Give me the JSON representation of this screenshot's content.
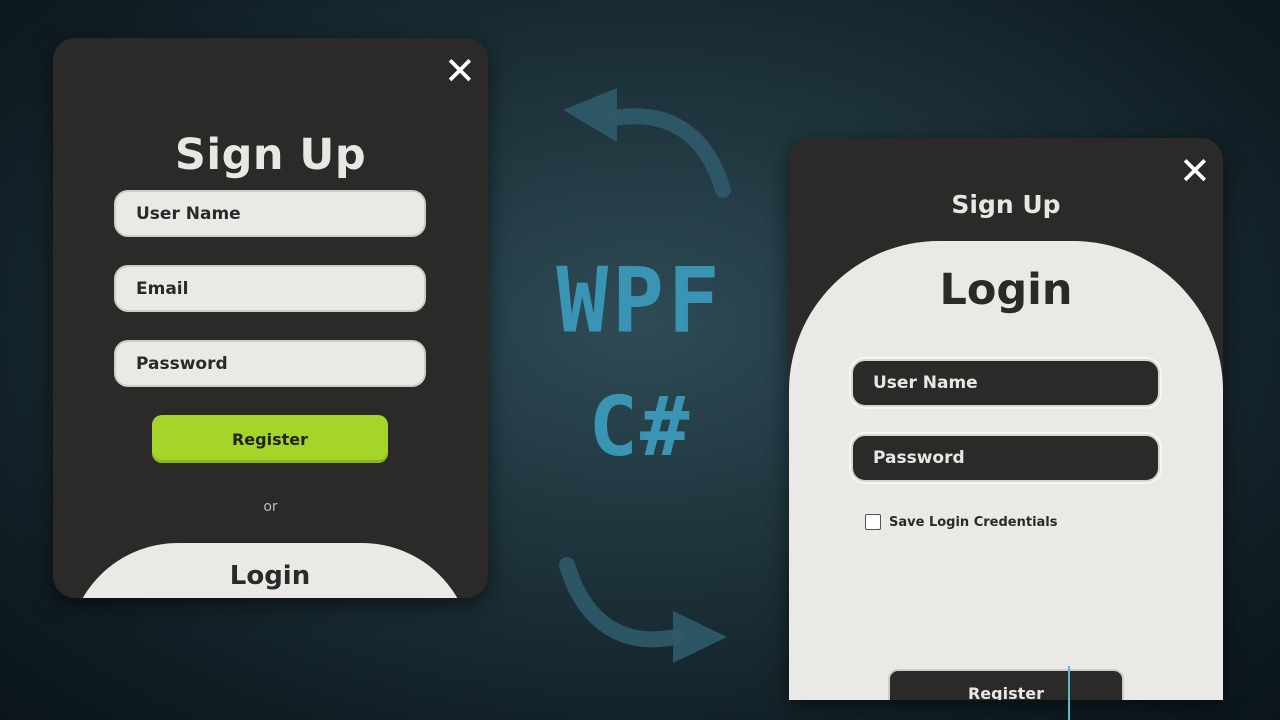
{
  "colors": {
    "background": "#1d3139",
    "window_dark": "#2b2a29",
    "panel_light": "#ebe9e6",
    "register_green": "#a6d52a",
    "accent_blue": "#3a95b4"
  },
  "center_text": {
    "line1": "WPF",
    "line2": "C#"
  },
  "left_window": {
    "close_icon": "✕",
    "title": "Sign Up",
    "username_placeholder": "User Name",
    "email_placeholder": "Email",
    "password_placeholder": "Password",
    "register_label": "Register",
    "or_text": "or",
    "login_label": "Login"
  },
  "right_window": {
    "close_icon": "✕",
    "signup_label": "Sign Up",
    "login_title": "Login",
    "username_placeholder": "User Name",
    "password_placeholder": "Password",
    "save_credentials_label": "Save Login Credentials",
    "save_credentials_checked": false,
    "register_label": "Register"
  },
  "icons": [
    "close-icon",
    "curved-arrow-icon",
    "checkbox-icon"
  ]
}
